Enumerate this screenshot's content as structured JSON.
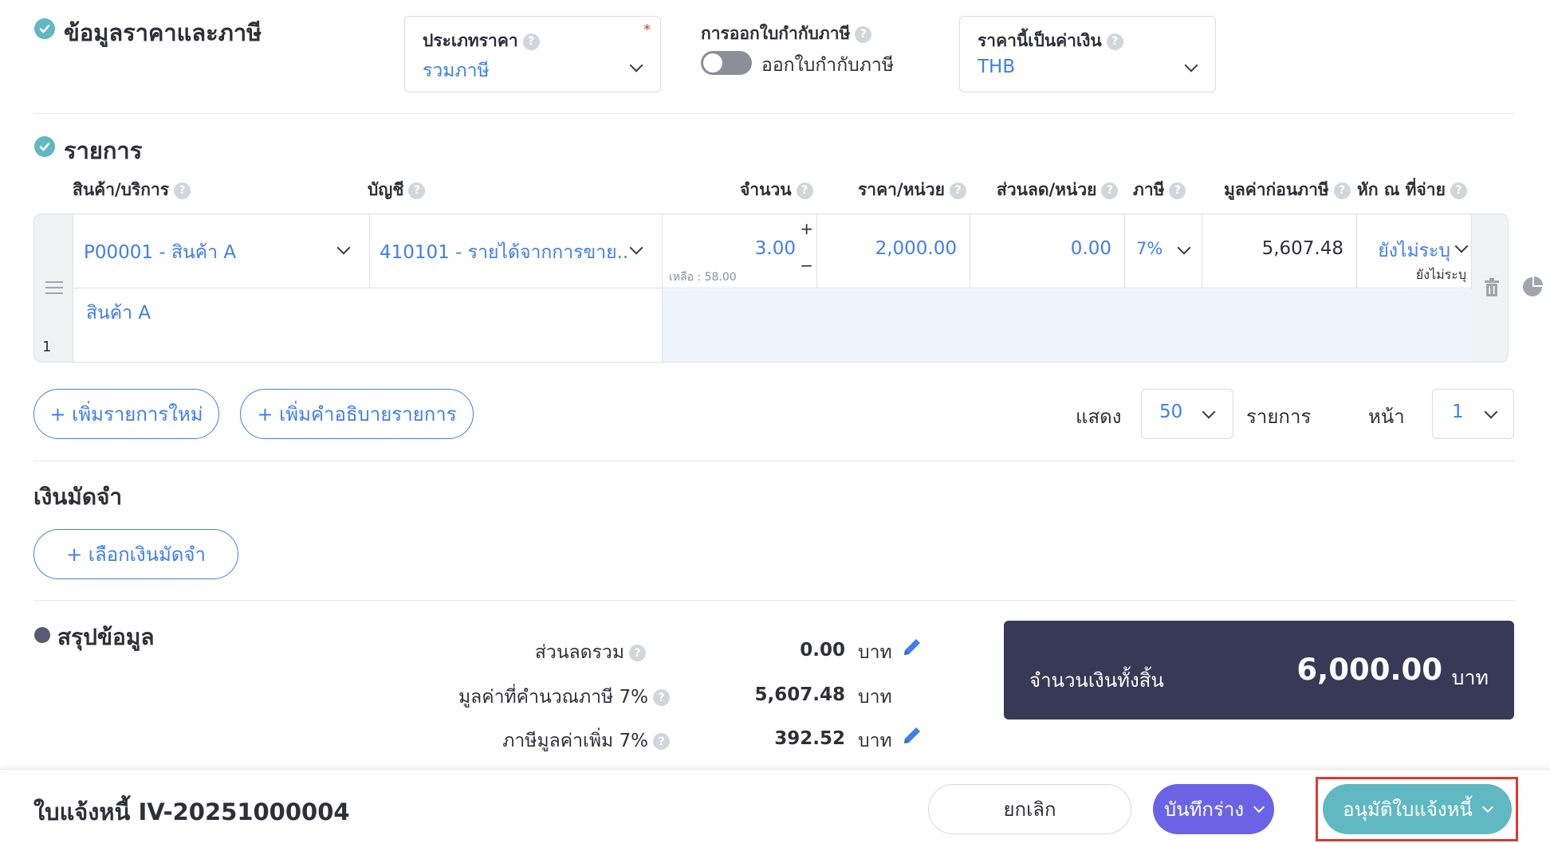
{
  "pricing": {
    "section_title": "ข้อมูลราคาและภาษี",
    "price_type_label": "ประเภทราคา",
    "price_type_value": "รวมภาษี",
    "tax_invoice_label": "การออกใบกำกับภาษี",
    "tax_invoice_toggle_label": "ออกใบกำกับภาษี",
    "tax_invoice_on": false,
    "currency_label": "ราคานี้เป็นค่าเงิน",
    "currency_value": "THB"
  },
  "items": {
    "section_title": "รายการ",
    "columns": {
      "product": "สินค้า/บริการ",
      "account": "บัญชี",
      "quantity": "จำนวน",
      "unit_price": "ราคา/หน่วย",
      "discount": "ส่วนลด/หน่วย",
      "tax": "ภาษี",
      "pretax": "มูลค่าก่อนภาษี",
      "withholding": "หัก ณ ที่จ่าย"
    },
    "row": {
      "index": "1",
      "product": "P00001 - สินค้า A",
      "account": "410101 - รายได้จากการขาย...",
      "quantity": "3.00",
      "remaining": "เหลือ : 58.00",
      "unit_price": "2,000.00",
      "discount": "0.00",
      "tax": "7%",
      "pretax": "5,607.48",
      "withholding": "ยังไม่ระบุ",
      "withholding_sub": "ยังไม่ระบุ",
      "description": "สินค้า A"
    },
    "add_item_label": "+ เพิ่มรายการใหม่",
    "add_desc_label": "+ เพิ่มคำอธิบายรายการ",
    "show_label": "แสดง",
    "per_page": "50",
    "items_label": "รายการ",
    "page_label": "หน้า",
    "page_value": "1"
  },
  "deposit": {
    "section_title": "เงินมัดจำ",
    "select_label": "+ เลือกเงินมัดจำ"
  },
  "summary": {
    "section_title": "สรุปข้อมูล",
    "rows": [
      {
        "label": "ส่วนลดรวม",
        "value": "0.00",
        "unit": "บาท"
      },
      {
        "label": "มูลค่าที่คำนวณภาษี 7%",
        "value": "5,607.48",
        "unit": "บาท"
      },
      {
        "label": "ภาษีมูลค่าเพิ่ม 7%",
        "value": "392.52",
        "unit": "บาท"
      }
    ],
    "total_label": "จำนวนเงินทั้งสิ้น",
    "total_value": "6,000.00",
    "total_unit": "บาท"
  },
  "footer": {
    "doc_title": "ใบแจ้งหนี้ IV-20251000004",
    "cancel_label": "ยกเลิก",
    "save_draft_label": "บันทึกร่าง",
    "approve_label": "อนุมัติใบแจ้งหนี้"
  },
  "colors": {
    "accent_blue": "#3f7fe8",
    "teal": "#5fb8c2",
    "purple": "#6b63e6",
    "navy": "#383956",
    "highlight_red": "#e2382f"
  }
}
